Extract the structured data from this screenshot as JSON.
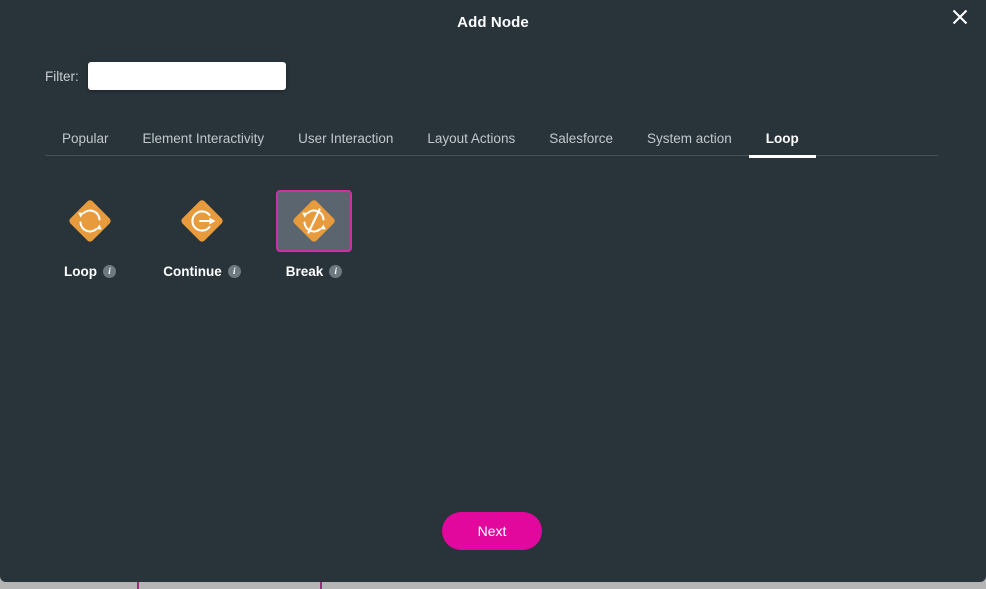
{
  "modal": {
    "title": "Add Node",
    "close_icon": "close-icon",
    "filter": {
      "label": "Filter:",
      "value": "",
      "placeholder": ""
    },
    "tabs": [
      {
        "label": "Popular",
        "active": false
      },
      {
        "label": "Element Interactivity",
        "active": false
      },
      {
        "label": "User Interaction",
        "active": false
      },
      {
        "label": "Layout Actions",
        "active": false
      },
      {
        "label": "Salesforce",
        "active": false
      },
      {
        "label": "System action",
        "active": false
      },
      {
        "label": "Loop",
        "active": true
      }
    ],
    "nodes": [
      {
        "label": "Loop",
        "icon": "loop-refresh-icon",
        "info_icon": "info-icon",
        "selected": false
      },
      {
        "label": "Continue",
        "icon": "continue-arrow-icon",
        "info_icon": "info-icon",
        "selected": false
      },
      {
        "label": "Break",
        "icon": "break-loop-slash-icon",
        "info_icon": "info-icon",
        "selected": true
      }
    ],
    "footer": {
      "next_label": "Next"
    }
  },
  "colors": {
    "modal_background": "#28333a",
    "node_orange": "#e89b3c",
    "accent_magenta": "#e2089e",
    "selection_border": "#cc2fa8",
    "selection_fill": "#5a6570",
    "page_behind": "#b5b5b5"
  }
}
